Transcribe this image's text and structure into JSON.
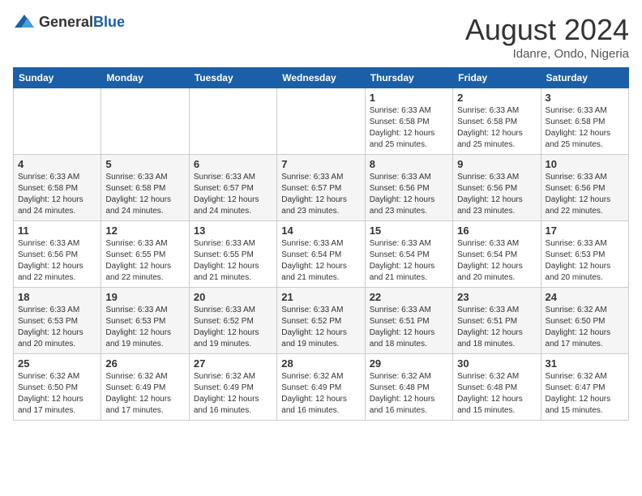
{
  "header": {
    "logo_general": "General",
    "logo_blue": "Blue",
    "month_year": "August 2024",
    "location": "Idanre, Ondo, Nigeria"
  },
  "days_of_week": [
    "Sunday",
    "Monday",
    "Tuesday",
    "Wednesday",
    "Thursday",
    "Friday",
    "Saturday"
  ],
  "weeks": [
    [
      {
        "day": "",
        "info": ""
      },
      {
        "day": "",
        "info": ""
      },
      {
        "day": "",
        "info": ""
      },
      {
        "day": "",
        "info": ""
      },
      {
        "day": "1",
        "info": "Sunrise: 6:33 AM\nSunset: 6:58 PM\nDaylight: 12 hours\nand 25 minutes."
      },
      {
        "day": "2",
        "info": "Sunrise: 6:33 AM\nSunset: 6:58 PM\nDaylight: 12 hours\nand 25 minutes."
      },
      {
        "day": "3",
        "info": "Sunrise: 6:33 AM\nSunset: 6:58 PM\nDaylight: 12 hours\nand 25 minutes."
      }
    ],
    [
      {
        "day": "4",
        "info": "Sunrise: 6:33 AM\nSunset: 6:58 PM\nDaylight: 12 hours\nand 24 minutes."
      },
      {
        "day": "5",
        "info": "Sunrise: 6:33 AM\nSunset: 6:58 PM\nDaylight: 12 hours\nand 24 minutes."
      },
      {
        "day": "6",
        "info": "Sunrise: 6:33 AM\nSunset: 6:57 PM\nDaylight: 12 hours\nand 24 minutes."
      },
      {
        "day": "7",
        "info": "Sunrise: 6:33 AM\nSunset: 6:57 PM\nDaylight: 12 hours\nand 23 minutes."
      },
      {
        "day": "8",
        "info": "Sunrise: 6:33 AM\nSunset: 6:56 PM\nDaylight: 12 hours\nand 23 minutes."
      },
      {
        "day": "9",
        "info": "Sunrise: 6:33 AM\nSunset: 6:56 PM\nDaylight: 12 hours\nand 23 minutes."
      },
      {
        "day": "10",
        "info": "Sunrise: 6:33 AM\nSunset: 6:56 PM\nDaylight: 12 hours\nand 22 minutes."
      }
    ],
    [
      {
        "day": "11",
        "info": "Sunrise: 6:33 AM\nSunset: 6:56 PM\nDaylight: 12 hours\nand 22 minutes."
      },
      {
        "day": "12",
        "info": "Sunrise: 6:33 AM\nSunset: 6:55 PM\nDaylight: 12 hours\nand 22 minutes."
      },
      {
        "day": "13",
        "info": "Sunrise: 6:33 AM\nSunset: 6:55 PM\nDaylight: 12 hours\nand 21 minutes."
      },
      {
        "day": "14",
        "info": "Sunrise: 6:33 AM\nSunset: 6:54 PM\nDaylight: 12 hours\nand 21 minutes."
      },
      {
        "day": "15",
        "info": "Sunrise: 6:33 AM\nSunset: 6:54 PM\nDaylight: 12 hours\nand 21 minutes."
      },
      {
        "day": "16",
        "info": "Sunrise: 6:33 AM\nSunset: 6:54 PM\nDaylight: 12 hours\nand 20 minutes."
      },
      {
        "day": "17",
        "info": "Sunrise: 6:33 AM\nSunset: 6:53 PM\nDaylight: 12 hours\nand 20 minutes."
      }
    ],
    [
      {
        "day": "18",
        "info": "Sunrise: 6:33 AM\nSunset: 6:53 PM\nDaylight: 12 hours\nand 20 minutes."
      },
      {
        "day": "19",
        "info": "Sunrise: 6:33 AM\nSunset: 6:53 PM\nDaylight: 12 hours\nand 19 minutes."
      },
      {
        "day": "20",
        "info": "Sunrise: 6:33 AM\nSunset: 6:52 PM\nDaylight: 12 hours\nand 19 minutes."
      },
      {
        "day": "21",
        "info": "Sunrise: 6:33 AM\nSunset: 6:52 PM\nDaylight: 12 hours\nand 19 minutes."
      },
      {
        "day": "22",
        "info": "Sunrise: 6:33 AM\nSunset: 6:51 PM\nDaylight: 12 hours\nand 18 minutes."
      },
      {
        "day": "23",
        "info": "Sunrise: 6:33 AM\nSunset: 6:51 PM\nDaylight: 12 hours\nand 18 minutes."
      },
      {
        "day": "24",
        "info": "Sunrise: 6:32 AM\nSunset: 6:50 PM\nDaylight: 12 hours\nand 17 minutes."
      }
    ],
    [
      {
        "day": "25",
        "info": "Sunrise: 6:32 AM\nSunset: 6:50 PM\nDaylight: 12 hours\nand 17 minutes."
      },
      {
        "day": "26",
        "info": "Sunrise: 6:32 AM\nSunset: 6:49 PM\nDaylight: 12 hours\nand 17 minutes."
      },
      {
        "day": "27",
        "info": "Sunrise: 6:32 AM\nSunset: 6:49 PM\nDaylight: 12 hours\nand 16 minutes."
      },
      {
        "day": "28",
        "info": "Sunrise: 6:32 AM\nSunset: 6:49 PM\nDaylight: 12 hours\nand 16 minutes."
      },
      {
        "day": "29",
        "info": "Sunrise: 6:32 AM\nSunset: 6:48 PM\nDaylight: 12 hours\nand 16 minutes."
      },
      {
        "day": "30",
        "info": "Sunrise: 6:32 AM\nSunset: 6:48 PM\nDaylight: 12 hours\nand 15 minutes."
      },
      {
        "day": "31",
        "info": "Sunrise: 6:32 AM\nSunset: 6:47 PM\nDaylight: 12 hours\nand 15 minutes."
      }
    ]
  ]
}
